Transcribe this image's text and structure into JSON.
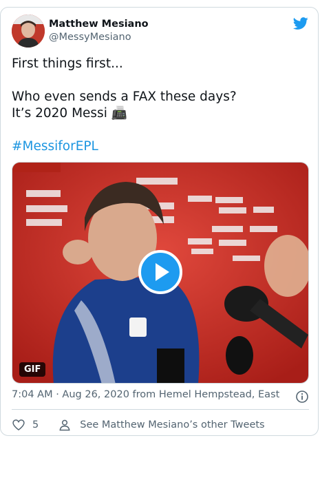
{
  "tweet": {
    "author": {
      "name": "Matthew Mesiano",
      "handle": "@MessyMesiano"
    },
    "text": {
      "line1": "First things first...",
      "line2": "Who even sends a FAX these days?",
      "line3": "It’s 2020 Messi 📠",
      "hashtag": "#MessiforEPL"
    },
    "media": {
      "badge": "GIF",
      "play_icon": "play-icon"
    },
    "meta": {
      "time_date": "7:04 AM · Aug 26, 2020",
      "source_prefix": "from",
      "location": "Hemel Hempstead, East"
    },
    "footer": {
      "likes": "5",
      "other_tweets": "See Matthew Mesiano’s other Tweets"
    }
  },
  "colors": {
    "twitter_blue": "#1d9bf0",
    "link_blue": "#1b95e0",
    "secondary_text": "#536471",
    "border": "#cfd9de"
  }
}
